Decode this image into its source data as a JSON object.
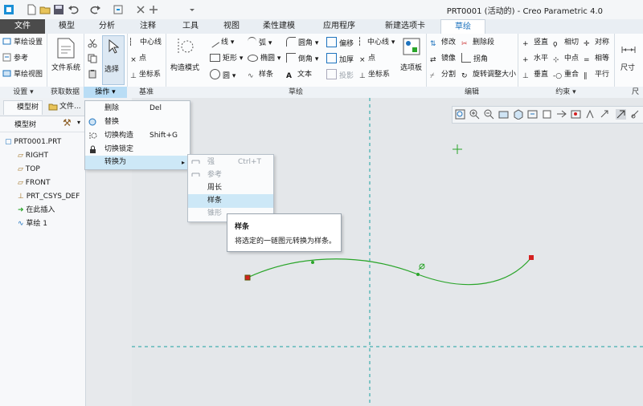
{
  "window": {
    "title": "PRT0001 (活动的) - Creo Parametric 4.0"
  },
  "tabs": [
    "文件",
    "模型",
    "分析",
    "注释",
    "工具",
    "视图",
    "柔性建模",
    "应用程序",
    "新建选项卡",
    "草绘"
  ],
  "ribbon": {
    "setup": {
      "sketch_setup": "草绘设置",
      "reference": "参考",
      "sketch_view": "草绘视图"
    },
    "get_data": {
      "file_system": "文件系统"
    },
    "operations": {
      "select": "选择"
    },
    "datum": {
      "centerline": "中心线",
      "point": "点",
      "coord_sys": "坐标系"
    },
    "sketch": {
      "construction_mode": "构造模式",
      "line": "线",
      "arc": "弧",
      "fillet": "圆角",
      "offset": "偏移",
      "centerline": "中心线",
      "rectangle": "矩形",
      "ellipse": "椭圆",
      "chamfer": "倒角",
      "thicken": "加厚",
      "point": "点",
      "circle": "圆",
      "spline": "样条",
      "text": "文本",
      "project": "投影",
      "coord_sys": "坐标系",
      "palette": "选项板"
    },
    "editing": {
      "modify": "修改",
      "delete_segment": "删除段",
      "mirror": "镜像",
      "corner": "拐角",
      "divide": "分割",
      "rotate_resize": "旋转调整大小"
    },
    "constrain": {
      "vertical": "竖直",
      "tangent": "相切",
      "symmetric": "对称",
      "horizontal": "水平",
      "midpoint": "中点",
      "equal": "相等",
      "perpendicular": "垂直",
      "coincident": "重合",
      "parallel": "平行"
    },
    "dimension": {
      "dimension": "尺寸"
    }
  },
  "groups": {
    "setup": "设置",
    "get_data": "获取数据",
    "operations": "操作",
    "datum": "基准",
    "sketch": "草绘",
    "editing": "编辑",
    "constrain": "约束",
    "dimension": "尺寸"
  },
  "nav": {
    "model_tree_tab": "模型树",
    "folder_tab": "文件...",
    "tree_header": "模型树"
  },
  "tree": {
    "items": [
      "PRT0001.PRT",
      "RIGHT",
      "TOP",
      "FRONT",
      "PRT_CSYS_DEF",
      "在此插入",
      "草绘 1"
    ]
  },
  "ops_menu": {
    "items": [
      {
        "label": "删除",
        "shortcut": "Del"
      },
      {
        "label": "替换",
        "shortcut": ""
      },
      {
        "label": "切换构造",
        "shortcut": "Shift+G"
      },
      {
        "label": "切换锁定",
        "shortcut": ""
      },
      {
        "label": "转换为",
        "shortcut": ""
      }
    ]
  },
  "convert_menu": {
    "items": [
      {
        "label": "强",
        "shortcut": "Ctrl+T",
        "disabled": true
      },
      {
        "label": "参考",
        "shortcut": "",
        "disabled": true
      },
      {
        "label": "周长",
        "shortcut": "",
        "disabled": false
      },
      {
        "label": "样条",
        "shortcut": "",
        "disabled": false
      },
      {
        "label": "锥形",
        "shortcut": "",
        "disabled": true
      }
    ]
  },
  "tooltip": {
    "title": "样条",
    "desc": "将选定的一链图元转换为样条。"
  },
  "colors": {
    "accent": "#1e73be",
    "curve": "#2aa52a",
    "endpoint": "#d42020",
    "axis": "#1aa0a0"
  }
}
